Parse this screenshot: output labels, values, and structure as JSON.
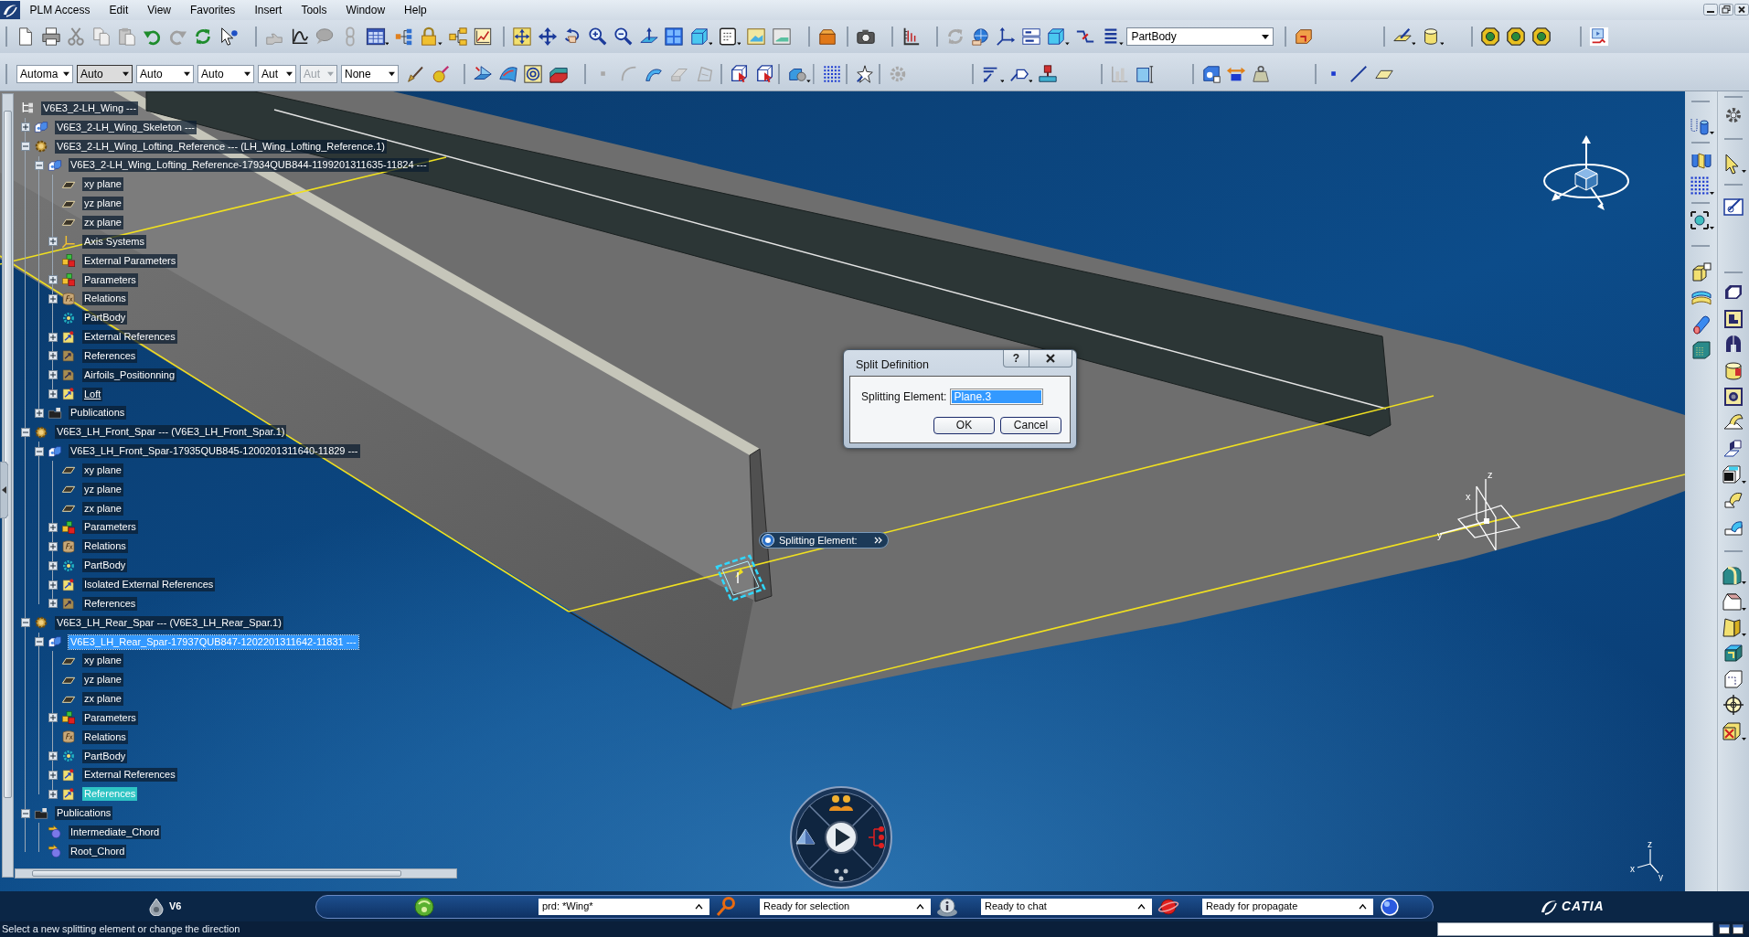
{
  "menu_bar": {
    "items": [
      "PLM Access",
      "Edit",
      "View",
      "Favorites",
      "Insert",
      "Tools",
      "Window",
      "Help"
    ]
  },
  "toolbar": {
    "combos": [
      {
        "value": "Automa",
        "focused": false,
        "disabled": false
      },
      {
        "value": "Auto",
        "focused": true,
        "disabled": false
      },
      {
        "value": "Auto",
        "focused": false,
        "disabled": false
      },
      {
        "value": "Auto",
        "focused": false,
        "disabled": false
      },
      {
        "value": "Aut",
        "focused": false,
        "disabled": false
      },
      {
        "value": "Aut",
        "focused": false,
        "disabled": true
      },
      {
        "value": "None",
        "focused": false,
        "disabled": false
      }
    ],
    "body_selector": "PartBody"
  },
  "tree": {
    "items": [
      {
        "label": "V6E3_2-LH_Wing ---",
        "kind": "root",
        "selected": false,
        "highlighted": false,
        "current": false,
        "children": [
          {
            "label": "V6E3_2-LH_Wing_Skeleton ---",
            "kind": "product",
            "expanded": false,
            "selected": false,
            "highlighted": false,
            "current": false
          },
          {
            "label": "V6E3_2-LH_Wing_Lofting_Reference --- (LH_Wing_Lofting_Reference.1)",
            "kind": "instance",
            "expanded": true,
            "selected": false,
            "highlighted": false,
            "current": false,
            "children": [
              {
                "label": "V6E3_2-LH_Wing_Lofting_Reference-17934QUB844-1199201311635-11824 ---",
                "kind": "product",
                "expanded": true,
                "selected": false,
                "highlighted": false,
                "current": false,
                "children": [
                  {
                    "label": "xy plane",
                    "kind": "plane",
                    "selected": false,
                    "highlighted": false,
                    "current": false
                  },
                  {
                    "label": "yz plane",
                    "kind": "plane",
                    "selected": false,
                    "highlighted": false,
                    "current": false
                  },
                  {
                    "label": "zx plane",
                    "kind": "plane",
                    "selected": false,
                    "highlighted": false,
                    "current": false
                  },
                  {
                    "label": "Axis Systems",
                    "kind": "axis",
                    "expanded": false,
                    "selected": false,
                    "highlighted": false,
                    "current": false
                  },
                  {
                    "label": "External Parameters",
                    "kind": "parameters",
                    "selected": false,
                    "highlighted": false,
                    "current": false
                  },
                  {
                    "label": "Parameters",
                    "kind": "parameters",
                    "expanded": false,
                    "selected": false,
                    "highlighted": false,
                    "current": false
                  },
                  {
                    "label": "Relations",
                    "kind": "relations",
                    "expanded": false,
                    "selected": false,
                    "highlighted": false,
                    "current": false
                  },
                  {
                    "label": "PartBody",
                    "kind": "body",
                    "selected": false,
                    "highlighted": false,
                    "current": false
                  },
                  {
                    "label": "External References",
                    "kind": "references",
                    "expanded": false,
                    "selected": false,
                    "highlighted": false,
                    "current": false
                  },
                  {
                    "label": "References",
                    "kind": "geoset",
                    "expanded": false,
                    "selected": false,
                    "highlighted": false,
                    "current": false
                  },
                  {
                    "label": "Airfoils_Positionning",
                    "kind": "geoset",
                    "expanded": false,
                    "selected": false,
                    "highlighted": false,
                    "current": false
                  },
                  {
                    "label": "Loft",
                    "kind": "references",
                    "expanded": false,
                    "selected": false,
                    "highlighted": false,
                    "current": true
                  }
                ]
              },
              {
                "label": "Publications",
                "kind": "publications",
                "expanded": false,
                "selected": false,
                "highlighted": false,
                "current": false
              }
            ]
          },
          {
            "label": "V6E3_LH_Front_Spar --- (V6E3_LH_Front_Spar.1)",
            "kind": "instance",
            "expanded": true,
            "selected": false,
            "highlighted": false,
            "current": false,
            "children": [
              {
                "label": "V6E3_LH_Front_Spar-17935QUB845-1200201311640-11829 ---",
                "kind": "product",
                "expanded": true,
                "selected": false,
                "highlighted": false,
                "current": false,
                "children": [
                  {
                    "label": "xy plane",
                    "kind": "plane",
                    "selected": false,
                    "highlighted": false,
                    "current": false
                  },
                  {
                    "label": "yz plane",
                    "kind": "plane",
                    "selected": false,
                    "highlighted": false,
                    "current": false
                  },
                  {
                    "label": "zx plane",
                    "kind": "plane",
                    "selected": false,
                    "highlighted": false,
                    "current": false
                  },
                  {
                    "label": "Parameters",
                    "kind": "parameters",
                    "expanded": false,
                    "selected": false,
                    "highlighted": false,
                    "current": false
                  },
                  {
                    "label": "Relations",
                    "kind": "relations",
                    "expanded": false,
                    "selected": false,
                    "highlighted": false,
                    "current": false
                  },
                  {
                    "label": "PartBody",
                    "kind": "body",
                    "expanded": false,
                    "selected": false,
                    "highlighted": false,
                    "current": false
                  },
                  {
                    "label": "Isolated External References",
                    "kind": "references",
                    "expanded": false,
                    "selected": false,
                    "highlighted": false,
                    "current": false
                  },
                  {
                    "label": "References",
                    "kind": "geoset",
                    "expanded": false,
                    "selected": false,
                    "highlighted": false,
                    "current": false
                  }
                ]
              }
            ]
          },
          {
            "label": "V6E3_LH_Rear_Spar --- (V6E3_LH_Rear_Spar.1)",
            "kind": "instance",
            "expanded": true,
            "selected": false,
            "highlighted": false,
            "current": false,
            "children": [
              {
                "label": "V6E3_LH_Rear_Spar-17937QUB847-1202201311642-11831 ---",
                "kind": "product",
                "expanded": true,
                "selected": true,
                "highlighted": false,
                "current": false,
                "children": [
                  {
                    "label": "xy plane",
                    "kind": "plane",
                    "selected": false,
                    "highlighted": false,
                    "current": false
                  },
                  {
                    "label": "yz plane",
                    "kind": "plane",
                    "selected": false,
                    "highlighted": false,
                    "current": false
                  },
                  {
                    "label": "zx plane",
                    "kind": "plane",
                    "selected": false,
                    "highlighted": false,
                    "current": false
                  },
                  {
                    "label": "Parameters",
                    "kind": "parameters",
                    "expanded": false,
                    "selected": false,
                    "highlighted": false,
                    "current": false
                  },
                  {
                    "label": "Relations",
                    "kind": "relations",
                    "selected": false,
                    "highlighted": false,
                    "current": false
                  },
                  {
                    "label": "PartBody",
                    "kind": "body",
                    "expanded": false,
                    "selected": false,
                    "highlighted": false,
                    "current": false
                  },
                  {
                    "label": "External References",
                    "kind": "references",
                    "expanded": false,
                    "selected": false,
                    "highlighted": false,
                    "current": false
                  },
                  {
                    "label": "References",
                    "kind": "references",
                    "expanded": false,
                    "selected": false,
                    "highlighted": true,
                    "current": false
                  }
                ]
              }
            ]
          },
          {
            "label": "Publications",
            "kind": "publications",
            "expanded": true,
            "selected": false,
            "highlighted": false,
            "current": false,
            "children": [
              {
                "label": "Intermediate_Chord",
                "kind": "publication",
                "selected": false,
                "highlighted": false,
                "current": false
              },
              {
                "label": "Root_Chord",
                "kind": "publication",
                "selected": false,
                "highlighted": false,
                "current": false
              }
            ]
          }
        ]
      }
    ]
  },
  "viewport": {
    "tooltip": "Splitting Element:",
    "plane_axis_labels": [
      "z",
      "x",
      "y"
    ],
    "corner_axis_labels": [
      "z",
      "x",
      "y"
    ]
  },
  "dialog": {
    "title": "Split Definition",
    "help": "?",
    "field_label": "Splitting Element:",
    "field_value": "Plane.3",
    "field_highlighted": true,
    "buttons": [
      "OK",
      "Cancel"
    ]
  },
  "bottom_bar": {
    "workspace": "V6",
    "channels": [
      "prd: *Wing*",
      "Ready for selection",
      "Ready to chat",
      "Ready for propagate"
    ],
    "brand": "CATIA"
  },
  "status_bar": {
    "message": "Select a new splitting element or change the direction"
  }
}
